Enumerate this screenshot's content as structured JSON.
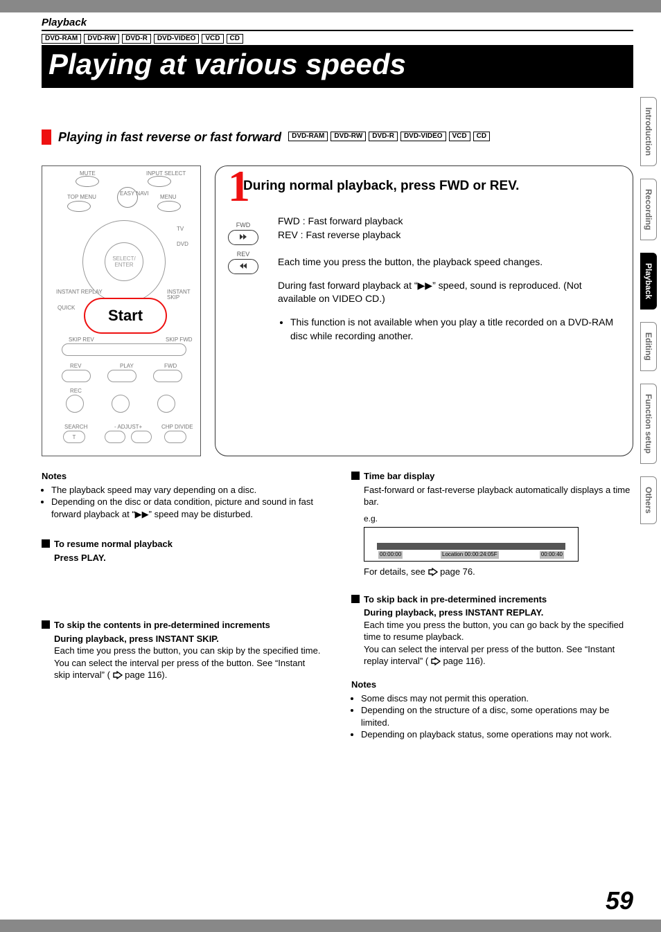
{
  "crumb": "Playback",
  "badges_top": [
    "DVD-RAM",
    "DVD-RW",
    "DVD-R",
    "DVD-VIDEO",
    "VCD",
    "CD"
  ],
  "title": "Playing at various speeds",
  "subhead": {
    "text": "Playing in fast reverse or fast forward",
    "badges": [
      "DVD-RAM",
      "DVD-RW",
      "DVD-R",
      "DVD-VIDEO",
      "VCD",
      "CD"
    ]
  },
  "remote": {
    "mute": "MUTE",
    "input": "INPUT SELECT",
    "topmenu": "TOP MENU",
    "easynavi": "EASY NAVI",
    "menu": "MENU",
    "tv": "TV",
    "dvd": "DVD",
    "select": "SELECT/ ENTER",
    "ireplay": "INSTANT REPLAY",
    "iskip": "INSTANT SKIP",
    "quick": "QUICK",
    "start": "Start",
    "skiprev": "SKIP REV",
    "skipfwd": "SKIP FWD",
    "rev": "REV",
    "play": "PLAY",
    "fwd": "FWD",
    "rec": "REC",
    "search": "SEARCH",
    "adjust": "- ADJUST+",
    "chp": "CHP DIVIDE",
    "t": "T"
  },
  "step": {
    "num": "1",
    "title": "During normal playback, press FWD or REV.",
    "fwd_label": "FWD",
    "rev_label": "REV",
    "def_fwd": "FWD : Fast forward playback",
    "def_rev": "REV :  Fast reverse playback",
    "p1": "Each time you press the button, the playback speed changes.",
    "p2": "During fast forward playback at “▶▶” speed, sound is reproduced. (Not available on VIDEO CD.)",
    "bullet1": "This function is not available when you play a title recorded on a DVD-RAM disc while recording another."
  },
  "left": {
    "notes_h": "Notes",
    "note1": "The playback speed may vary depending on a disc.",
    "note2": "Depending on the disc or data condition, picture and sound in fast forward playback at “▶▶” speed may be disturbed.",
    "resume_h": "To resume normal playback",
    "resume_b": "Press PLAY.",
    "skipfwd_h": "To skip the contents in pre-determined increments",
    "skipfwd_dir": "During playback, press INSTANT SKIP.",
    "skipfwd_b1": "Each time you press the button, you can skip by the specified time.",
    "skipfwd_b2a": "You can select the interval per press of the button. See “Instant skip interval” (",
    "skipfwd_b2b": " page 116)."
  },
  "right": {
    "timebar_h": "Time bar display",
    "timebar_b": "Fast-forward or fast-reverse playback automatically displays a time bar.",
    "eg": "e.g.",
    "tb_l": "00:00:00",
    "tb_m": "Location 00:00:24:05F",
    "tb_r": "00:00:40",
    "details_a": "For details, see ",
    "details_b": " page 76.",
    "skipback_h": "To skip back in pre-determined increments",
    "skipback_dir": "During playback, press INSTANT REPLAY.",
    "skipback_b1": "Each time you press the button, you can go back by the specified time to resume playback.",
    "skipback_b2a": "You can select the interval per press of the button. See “Instant replay interval” (",
    "skipback_b2b": " page 116).",
    "notes2_h": "Notes",
    "n2a": "Some discs may not permit this operation.",
    "n2b": "Depending on the structure of a disc, some operations may be limited.",
    "n2c": "Depending on playback status, some operations may not work."
  },
  "tabs": [
    "Introduction",
    "Recording",
    "Playback",
    "Editing",
    "Function setup",
    "Others"
  ],
  "active_tab": "Playback",
  "page_num": "59"
}
